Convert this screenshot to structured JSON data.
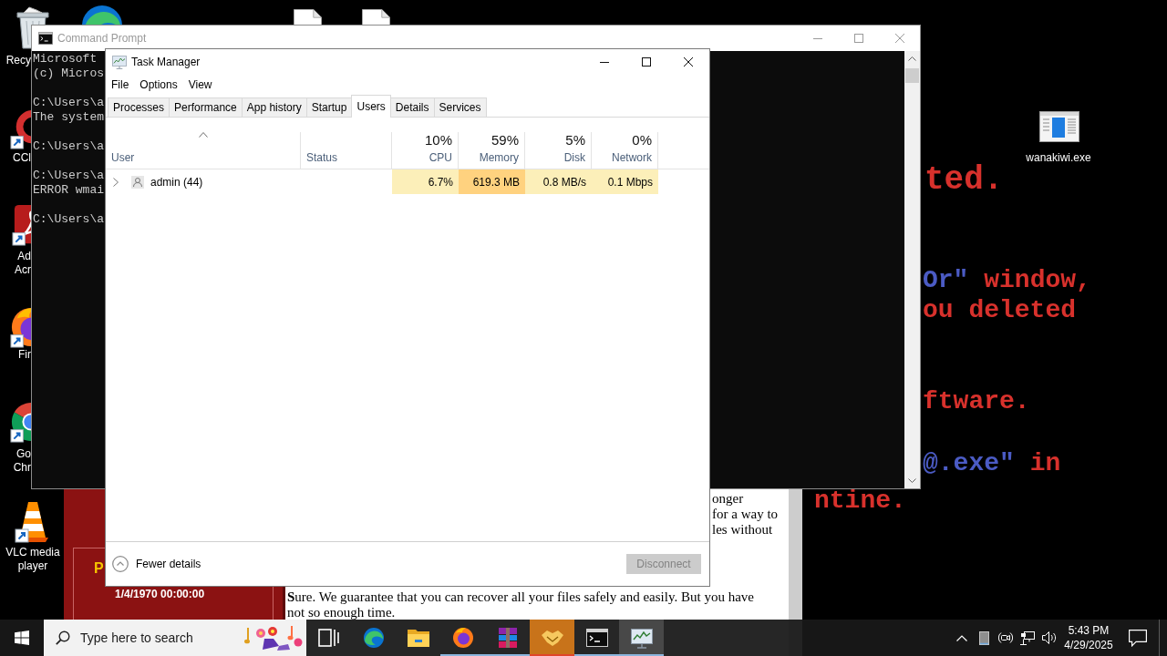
{
  "wallpaper": {
    "lines": [
      {
        "kind": "heading",
        "parts": [
          {
            "text": "ted.",
            "color": "#d8312c"
          }
        ]
      },
      {
        "kind": "body",
        "parts": [
          {
            "text": "Or\"",
            "color": "#4b5bc4"
          },
          {
            "text": " window,",
            "color": "#d8312c"
          }
        ]
      },
      {
        "kind": "body",
        "parts": [
          {
            "text": "ou deleted",
            "color": "#d8312c"
          }
        ]
      },
      {
        "kind": "body",
        "parts": [
          {
            "text": "ftware.",
            "color": "#d8312c"
          }
        ]
      },
      {
        "kind": "body",
        "parts": [
          {
            "text": "@.exe\"",
            "color": "#4b5bc4"
          },
          {
            "text": " in",
            "color": "#d8312c"
          }
        ]
      },
      {
        "kind": "body",
        "parts": [
          {
            "text": "ntine.",
            "color": "#d8312c"
          }
        ]
      }
    ]
  },
  "desktop_icons": [
    {
      "kind": "recycle-bin",
      "shortcut": false,
      "label_lines": [
        "Recy"
      ]
    },
    {
      "kind": "cleaner",
      "shortcut": true,
      "label_lines": [
        "CCl"
      ]
    },
    {
      "kind": "pdf-reader",
      "shortcut": true,
      "label_lines": [
        "Ad",
        "Acr"
      ]
    },
    {
      "kind": "firefox",
      "shortcut": true,
      "label_lines": [
        "Fir"
      ]
    },
    {
      "kind": "chrome",
      "shortcut": true,
      "label_lines": [
        "Go",
        "Chr"
      ]
    },
    {
      "kind": "vlc",
      "shortcut": true,
      "label_lines": [
        "VLC media",
        "player"
      ]
    },
    {
      "kind": "edge"
    },
    {
      "kind": "file"
    },
    {
      "kind": "file"
    },
    {
      "kind": "program",
      "label_lines": [
        "wanakiwi.exe"
      ]
    }
  ],
  "decryptor_window": {
    "timer_label": "P",
    "timer_value": "1/4/1970 00:00:00",
    "text_fragments": [
      "onger",
      "for a way to",
      "les without"
    ],
    "paragraph": "**S**ure. We guarantee that you can recover all your files safely and easily. But you have not so enough time."
  },
  "command_prompt": {
    "title": "Command Prompt",
    "active": false,
    "output_blocks": [
      [
        "Microsoft",
        "(c) Micros"
      ],
      [
        "C:\\Users\\a",
        "The system"
      ],
      [
        "C:\\Users\\a"
      ],
      [
        "C:\\Users\\a",
        "ERROR wmai"
      ],
      [
        "C:\\Users\\a"
      ]
    ]
  },
  "task_manager": {
    "title": "Task Manager",
    "active": true,
    "menu": [
      "File",
      "Options",
      "View"
    ],
    "tabs": [
      {
        "label": "Processes",
        "selected": false
      },
      {
        "label": "Performance",
        "selected": false
      },
      {
        "label": "App history",
        "selected": false
      },
      {
        "label": "Startup",
        "selected": false
      },
      {
        "label": "Users",
        "selected": true
      },
      {
        "label": "Details",
        "selected": false
      },
      {
        "label": "Services",
        "selected": false
      }
    ],
    "columns": [
      {
        "label": "User",
        "sorted": true
      },
      {
        "label": "Status",
        "sorted": false
      },
      {
        "label": "CPU",
        "total": "10%",
        "sorted": false
      },
      {
        "label": "Memory",
        "total": "59%",
        "sorted": false
      },
      {
        "label": "Disk",
        "total": "5%",
        "sorted": false
      },
      {
        "label": "Network",
        "total": "0%",
        "sorted": false
      }
    ],
    "rows": [
      {
        "expanded": false,
        "cells": [
          {
            "text": "admin (44)"
          },
          {
            "text": ""
          },
          {
            "text": "6.7%",
            "color": "#fcefb9"
          },
          {
            "text": "619.3 MB",
            "color": "#ffd27f"
          },
          {
            "text": "0.8 MB/s",
            "color": "#fcefb9"
          },
          {
            "text": "0.1 Mbps",
            "color": "#fcefb9"
          }
        ]
      }
    ],
    "footer": {
      "toggle": "Fewer details",
      "disconnect": {
        "label": "Disconnect",
        "disabled": true
      }
    }
  },
  "taskbar": {
    "search_placeholder": "Type here to search",
    "apps": [
      {
        "kind": "task-view",
        "running": false,
        "selected": false,
        "flashing": false
      },
      {
        "kind": "edge",
        "running": false,
        "selected": false,
        "flashing": false
      },
      {
        "kind": "explorer",
        "running": false,
        "selected": false,
        "flashing": false
      },
      {
        "kind": "firefox",
        "running": true,
        "selected": false,
        "flashing": false
      },
      {
        "kind": "winrar",
        "running": true,
        "selected": false,
        "flashing": false
      },
      {
        "kind": "handshake",
        "running": true,
        "selected": false,
        "flashing": true
      },
      {
        "kind": "terminal",
        "running": true,
        "selected": false,
        "flashing": false
      },
      {
        "kind": "task-manager",
        "running": true,
        "selected": true,
        "flashing": false
      }
    ],
    "tray": [
      {
        "kind": "chevron"
      },
      {
        "kind": "tile"
      },
      {
        "kind": "camera"
      },
      {
        "kind": "network"
      },
      {
        "kind": "volume"
      }
    ],
    "clock": {
      "time": "5:43 PM",
      "date": "4/29/2025"
    }
  }
}
